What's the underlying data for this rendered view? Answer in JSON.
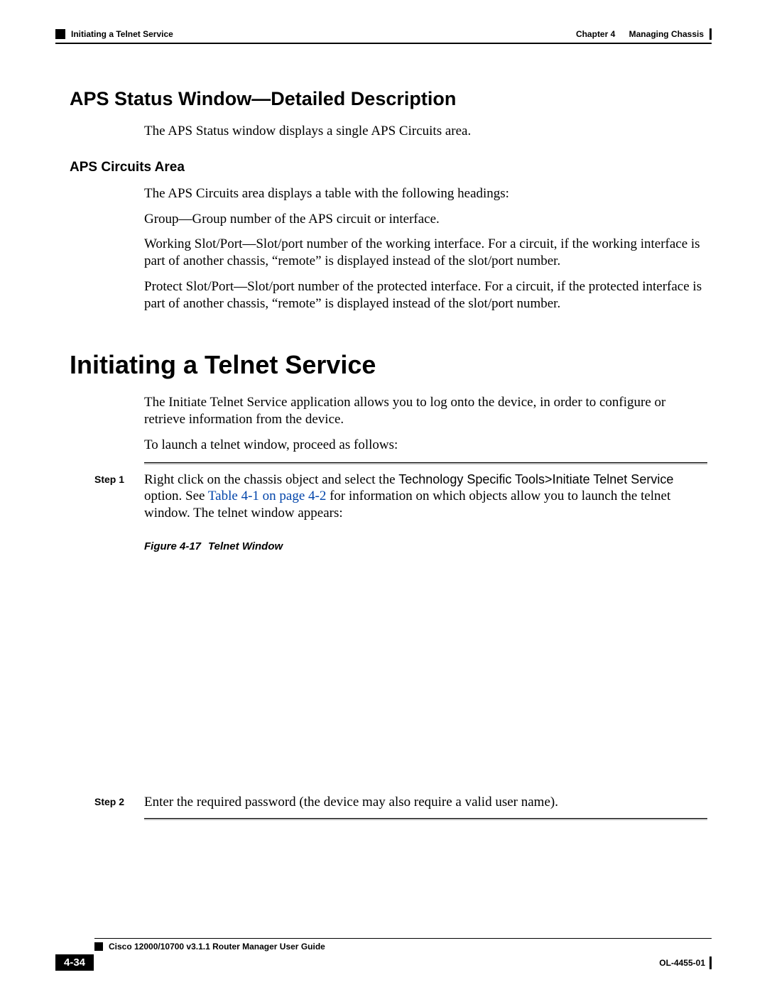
{
  "header": {
    "section_title": "Initiating a Telnet Service",
    "chapter_label": "Chapter 4",
    "chapter_title": "Managing Chassis"
  },
  "h2_aps_status": "APS Status Window—Detailed Description",
  "p_aps_status_intro": "The APS Status window displays a single APS Circuits area.",
  "h3_aps_circuits": "APS Circuits Area",
  "p_circuits_intro": "The APS Circuits area displays a table with the following headings:",
  "p_group": "Group—Group number of the APS circuit or interface.",
  "p_working": "Working Slot/Port—Slot/port number of the working interface. For a circuit, if the working interface is part of another chassis, “remote” is displayed instead of the slot/port number.",
  "p_protect": "Protect Slot/Port—Slot/port number of the protected interface. For a circuit, if the protected interface is part of another chassis, “remote” is displayed instead of the slot/port number.",
  "h1_telnet": "Initiating a Telnet Service",
  "p_telnet_intro": "The Initiate Telnet Service application allows you to log onto the device, in order to configure or retrieve information from the device.",
  "p_telnet_launch": "To launch a telnet window, proceed as follows:",
  "steps": {
    "step1_label": "Step 1",
    "step1_pre": "Right click on the chassis object and select the ",
    "step1_menu": "Technology Specific Tools>Initiate Telnet Service",
    "step1_post_a": " option. See ",
    "step1_xref": "Table 4-1 on page 4-2",
    "step1_post_b": " for information on which objects allow you to launch the telnet window. The telnet window appears:",
    "step2_label": "Step 2",
    "step2_body": "Enter the required password (the device may also require a valid user name)."
  },
  "figure": {
    "number": "Figure 4-17",
    "title": "Telnet Window"
  },
  "footer": {
    "guide": "Cisco 12000/10700 v3.1.1 Router Manager User Guide",
    "page": "4-34",
    "doc_id": "OL-4455-01"
  }
}
